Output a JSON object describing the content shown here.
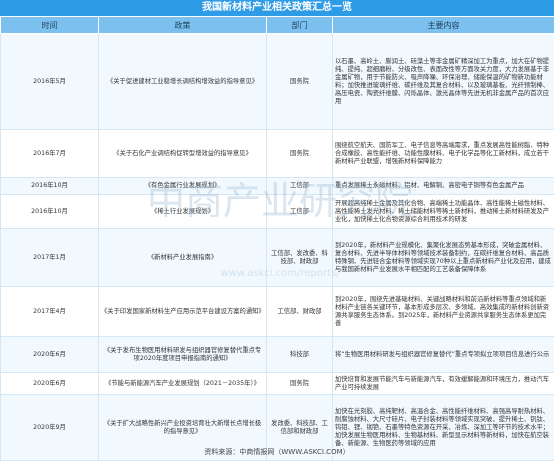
{
  "title": "我国新材料产业相关政策汇总一览",
  "headers": [
    "时间",
    "政策",
    "部门",
    "主要内容"
  ],
  "rows": [
    {
      "time": "2016年5月",
      "policy": "《关于促进建材工业稳增长调结构增效益的指导意见》",
      "dept": "国务院",
      "content": "以石墨、高岭土、膨润土、硅藻土等非金属矿精深加工为重点，加大在矿物提纯、提纯、超细磨粉、分级改性、表面改性等方面攻关力度，大力发展基于非金属矿物，用于节能防火、吸声降噪、环保治理、储能保温的矿物新功能材料；加快推进玻璃纤维、碳纤维及其复合材料、以及玻璃基板、光纤预制棒、高压电瓷、陶瓷纤维膜、闪烁晶体、激光晶体等先进无机非金属产品的首次应用"
    },
    {
      "time": "2016年7月",
      "policy": "《关于石化产业调结构促转型增效益的指导意见》",
      "dept": "国务院",
      "content": "围绕航空航天、国防军工、电子信息等高端需求，重点发展高性能树脂、特种合成橡胶、高性能纤维、功能性膜材料、电子化学品等化工新材料，成立若干新材料产业联盟，增强新材料保障能力"
    },
    {
      "time": "2016年10月",
      "policy": "《有色金属行业发展规划》",
      "dept": "工信部",
      "content": "重点发展稀土永磁材料、铝材、电解铜、高密电子铜等有色金属产品"
    },
    {
      "time": "2016年10月",
      "policy": "《稀土行业发展规划》",
      "dept": "工信部",
      "content": "开展超高纯稀土金属及其化合物、高端稀土功能晶体、高性能稀土磁性材料、高性能稀土发光材料、稀土储能材料等稀土新材料，推动稀土新材料研发及产业化，加快稀土化合物资源综合利用技术的研发"
    },
    {
      "time": "2017年1月",
      "policy": "《新材料产业发展指南》",
      "dept": "工信部、发改委、科技部、财政部",
      "content": "到2020年，新材料产业规模化、集聚化发展态势基本形成，突破金属材料、复合材料、先进半导体材料等领域技术装备制约，在碳纤维复合材料、高品质特殊钢、先进轻合金材料等领域实现70种以上重点新材料产业化及应用，建成与我国新材料产业发展水平相匹配的工艺装备保障体系"
    },
    {
      "time": "2017年4月",
      "policy": "《关于印发国家新材料生产应用示范平台建设方案的通知》",
      "dept": "工信部、财政部",
      "content": "到2020年，围绕先进基础材料、关键战略材料和前沿新材料等重点领域和新材料产业链各关键环节，基本形成多层次、多领域、高效集成的新材料创新资源共享服务生态体系。到2025年，新材料产业资源共享服务生态体系更加完善"
    },
    {
      "time": "2020年6月",
      "policy": "《关于发布生物医用材料研发与组织器官修复替代重点专项2020年度项目申报指南的通知》",
      "dept": "科技部",
      "content": "将“生物医用材料研发与组织器官修复替代”重点专项拟立项项目信息进行公示"
    },
    {
      "time": "2020年6月",
      "policy": "《节能与新能源汽车产业发展规划（2021－2035年）》",
      "dept": "国务院",
      "content": "加快培育和发展节能汽车与新能源汽车，有效缓解能源和环境压力，推动汽车产业可持续发展"
    },
    {
      "time": "2020年9月",
      "policy": "《关于扩大战略性新兴产业投资培育壮大新增长点增长极的指导意见》",
      "dept": "发改委、科技部、工信部和财政部",
      "content": "加快在光刻胶、高纯靶材、高温合金、高性能纤维材料、高强高导耐热材料、耐腐蚀材料、大尺寸硅片、电子封装材料等领域实现突破，提升稀土、钒钛、钨钼、锂、铷铯、石墨等特色资源在开采、冶炼、深加工等环节的技术水平；加快发展生物医用材料、生物基材料、新型显示材料等新材料，加快在航空装备、新能源、生物医药等领域的应用"
    }
  ],
  "watermark": "中商产业研究院",
  "watermark_url": "www.askci.com/reports/",
  "source": "资料来源：中商情报网（WWW.ASKCI.COM）",
  "colors": {
    "title_bg": "#2e9be6",
    "header_bg": "#7cc0ef",
    "row_alt": "#f2f9fe"
  }
}
